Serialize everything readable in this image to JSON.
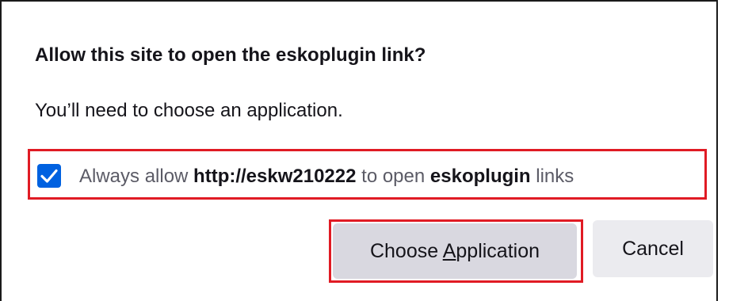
{
  "dialog": {
    "title": "Allow this site to open the eskoplugin link?",
    "message": "You’ll need to choose an application.",
    "checkbox": {
      "checked": true,
      "label_prefix": "Always allow ",
      "site": "http://eskw210222",
      "label_middle": " to open ",
      "scheme": "eskoplugin",
      "label_suffix": " links"
    },
    "buttons": {
      "choose_before_accesskey": "Choose ",
      "choose_accesskey": "A",
      "choose_after_accesskey": "pplication",
      "cancel_label": "Cancel"
    },
    "colors": {
      "checkbox_fill": "#0061e0",
      "highlight_border": "#e01b24",
      "primary_button_bg": "#d9d8e0",
      "secondary_button_bg": "#ebebef"
    }
  }
}
